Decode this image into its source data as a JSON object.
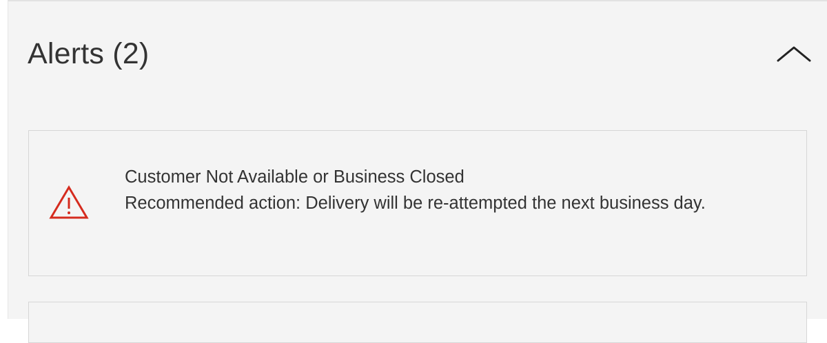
{
  "alerts_section": {
    "title": "Alerts (2)",
    "collapse_icon": "chevron-up-icon",
    "items": [
      {
        "icon": "warning-triangle-icon",
        "icon_color": "#d52b1e",
        "title": "Customer Not Available or Business Closed",
        "recommended_action": "Recommended action: Delivery will be re-attempted the next business day."
      }
    ]
  },
  "colors": {
    "background": "#f4f4f4",
    "text": "#333333",
    "alert_red": "#d52b1e",
    "border": "#d6d6d6"
  }
}
